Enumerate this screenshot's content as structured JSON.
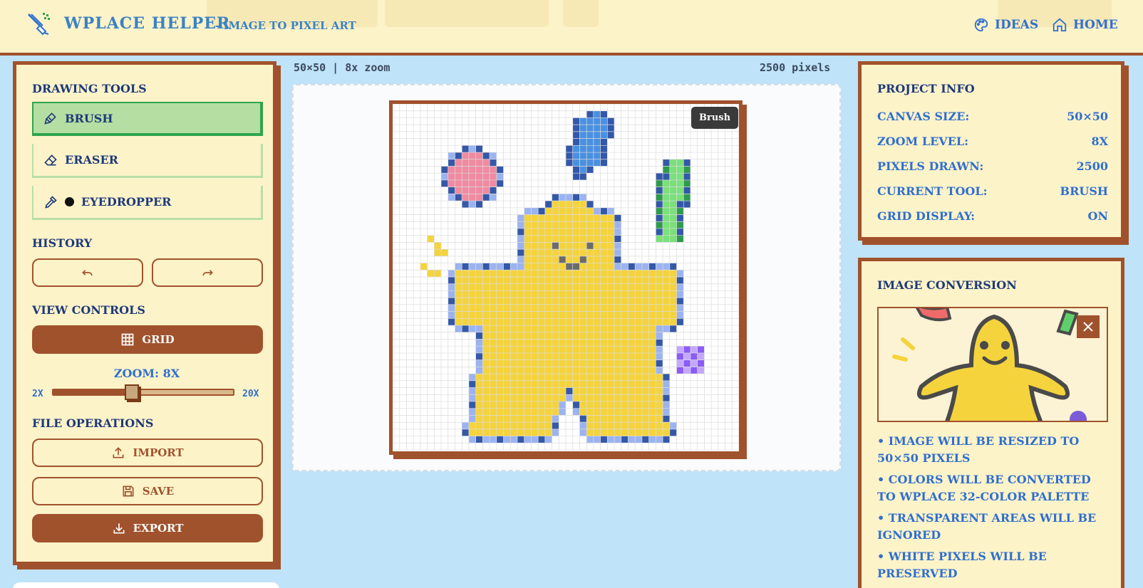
{
  "header": {
    "title": "WPLACE HELPER",
    "subtitle": "- IMAGE TO PIXEL ART",
    "nav": {
      "ideas": "IDEAS",
      "home": "HOME"
    }
  },
  "left": {
    "drawing_tools_title": "DRAWING TOOLS",
    "tools": {
      "brush": "BRUSH",
      "eraser": "ERASER",
      "eyedropper": "EYEDROPPER"
    },
    "history_title": "HISTORY",
    "view_controls_title": "VIEW CONTROLS",
    "grid_label": "GRID",
    "zoom_label": "ZOOM: 8X",
    "zoom_min": "2X",
    "zoom_max": "20X",
    "zoom_value": 8,
    "zoom_range": [
      2,
      20
    ],
    "file_ops_title": "FILE OPERATIONS",
    "import_label": "IMPORT",
    "save_label": "SAVE",
    "export_label": "EXPORT"
  },
  "center": {
    "canvas_info": "50×50 | 8x zoom",
    "pixel_count": "2500 pixels",
    "badge": "Brush"
  },
  "right": {
    "project_info_title": "PROJECT INFO",
    "info": [
      {
        "label": "CANVAS SIZE:",
        "value": "50×50"
      },
      {
        "label": "ZOOM LEVEL:",
        "value": "8X"
      },
      {
        "label": "PIXELS DRAWN:",
        "value": "2500"
      },
      {
        "label": "CURRENT TOOL:",
        "value": "BRUSH"
      },
      {
        "label": "GRID DISPLAY:",
        "value": "ON"
      }
    ],
    "image_conversion_title": "IMAGE CONVERSION",
    "notes": [
      "• IMAGE WILL BE RESIZED TO 50×50 PIXELS",
      "• COLORS WILL BE CONVERTED TO WPLACE 32-COLOR PALETTE",
      "• TRANSPARENT AREAS WILL BE IGNORED",
      "• WHITE PIXELS WILL BE PRESERVED"
    ]
  },
  "colors": {
    "accent": "#a0522d",
    "panel": "#fdf3c8",
    "background": "#bfe3f9",
    "active_tool": "#b5dea2",
    "text_blue": "#2f6fcf"
  }
}
